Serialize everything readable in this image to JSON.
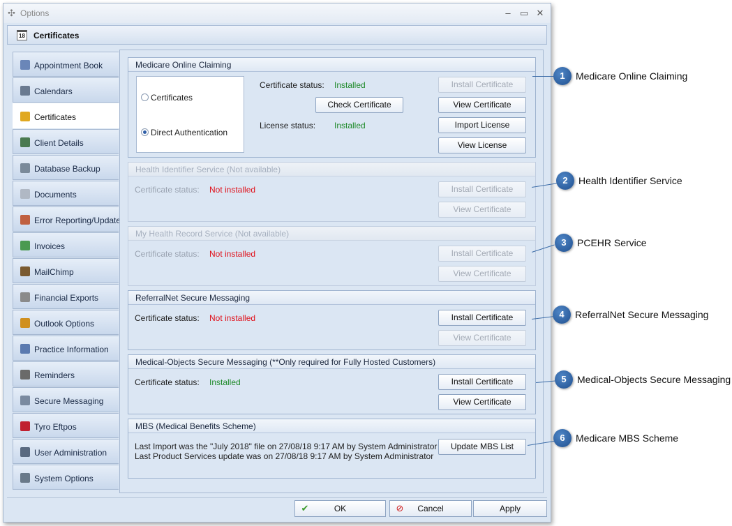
{
  "window": {
    "title": "Options",
    "controls": {
      "minimize": "–",
      "maximize": "▭",
      "close": "✕"
    }
  },
  "header": {
    "title": "Certificates",
    "icon": "calendar-icon",
    "icon_text": "18"
  },
  "sidebar": {
    "items": [
      {
        "label": "Appointment Book",
        "icon": "appointment-book-icon",
        "color": "#6a86b8"
      },
      {
        "label": "Calendars",
        "icon": "calendar-icon",
        "color": "#6a7a90"
      },
      {
        "label": "Certificates",
        "icon": "certificate-ribbon-icon",
        "color": "#e0a820",
        "active": true
      },
      {
        "label": "Client Details",
        "icon": "clients-icon",
        "color": "#4a7a50"
      },
      {
        "label": "Database Backup",
        "icon": "database-icon",
        "color": "#7a8a9a"
      },
      {
        "label": "Documents",
        "icon": "document-icon",
        "color": "#b0b8c4"
      },
      {
        "label": "Error Reporting/Updates",
        "icon": "error-report-icon",
        "color": "#c06040"
      },
      {
        "label": "Invoices",
        "icon": "invoice-icon",
        "color": "#4a9a50"
      },
      {
        "label": "MailChimp",
        "icon": "mailchimp-icon",
        "color": "#7a5a30"
      },
      {
        "label": "Financial Exports",
        "icon": "export-icon",
        "color": "#8a8a8a"
      },
      {
        "label": "Outlook Options",
        "icon": "outlook-icon",
        "color": "#d09020"
      },
      {
        "label": "Practice Information",
        "icon": "practice-icon",
        "color": "#5a7ab0"
      },
      {
        "label": "Reminders",
        "icon": "reminder-clock-icon",
        "color": "#6a6a6a"
      },
      {
        "label": "Secure Messaging",
        "icon": "secure-message-icon",
        "color": "#7a8aa0"
      },
      {
        "label": "Tyro Eftpos",
        "icon": "tyro-icon",
        "color": "#c02030"
      },
      {
        "label": "User Administration",
        "icon": "user-admin-icon",
        "color": "#5a6a80"
      },
      {
        "label": "System Options",
        "icon": "system-options-icon",
        "color": "#6a7a8a"
      }
    ]
  },
  "panels": {
    "medicare": {
      "title": "Medicare Online Claiming",
      "radio_certificates": "Certificates",
      "radio_direct": "Direct Authentication",
      "cert_status_label": "Certificate status:",
      "cert_status_value": "Installed",
      "license_status_label": "License status:",
      "license_status_value": "Installed",
      "check_certificate": "Check Certificate",
      "install_certificate": "Install Certificate",
      "view_certificate": "View Certificate",
      "import_license": "Import License",
      "view_license": "View License"
    },
    "his": {
      "title": "Health Identifier Service (Not available)",
      "cert_status_label": "Certificate status:",
      "cert_status_value": "Not installed",
      "install_certificate": "Install Certificate",
      "view_certificate": "View Certificate"
    },
    "mhr": {
      "title": "My Health Record Service (Not available)",
      "cert_status_label": "Certificate status:",
      "cert_status_value": "Not installed",
      "install_certificate": "Install Certificate",
      "view_certificate": "View Certificate"
    },
    "referralnet": {
      "title": "ReferralNet Secure Messaging",
      "cert_status_label": "Certificate status:",
      "cert_status_value": "Not installed",
      "install_certificate": "Install Certificate",
      "view_certificate": "View Certificate"
    },
    "medobjects": {
      "title": "Medical-Objects Secure Messaging (**Only required for Fully Hosted Customers)",
      "cert_status_label": "Certificate status:",
      "cert_status_value": "Installed",
      "install_certificate": "Install Certificate",
      "view_certificate": "View Certificate"
    },
    "mbs": {
      "title": "MBS (Medical Benefits Scheme)",
      "line1": "Last Import was the \"July 2018\" file on 27/08/18 9:17 AM by System Administrator",
      "line2": "Last Product  Services update was on 27/08/18 9:17 AM by System Administrator",
      "update_button": "Update MBS List"
    }
  },
  "footer": {
    "ok": "OK",
    "cancel": "Cancel",
    "apply": "Apply"
  },
  "callouts": [
    {
      "num": "1",
      "text": "Medicare Online Claiming"
    },
    {
      "num": "2",
      "text": "Health Identifier Service"
    },
    {
      "num": "3",
      "text": "PCEHR Service"
    },
    {
      "num": "4",
      "text": "ReferralNet Secure Messaging"
    },
    {
      "num": "5",
      "text": "Medical-Objects Secure Messaging"
    },
    {
      "num": "6",
      "text": "Medicare MBS Scheme"
    }
  ],
  "colors": {
    "installed": "#1f8a2a",
    "not_installed": "#e0101a",
    "callout": "#2a5fa0"
  }
}
